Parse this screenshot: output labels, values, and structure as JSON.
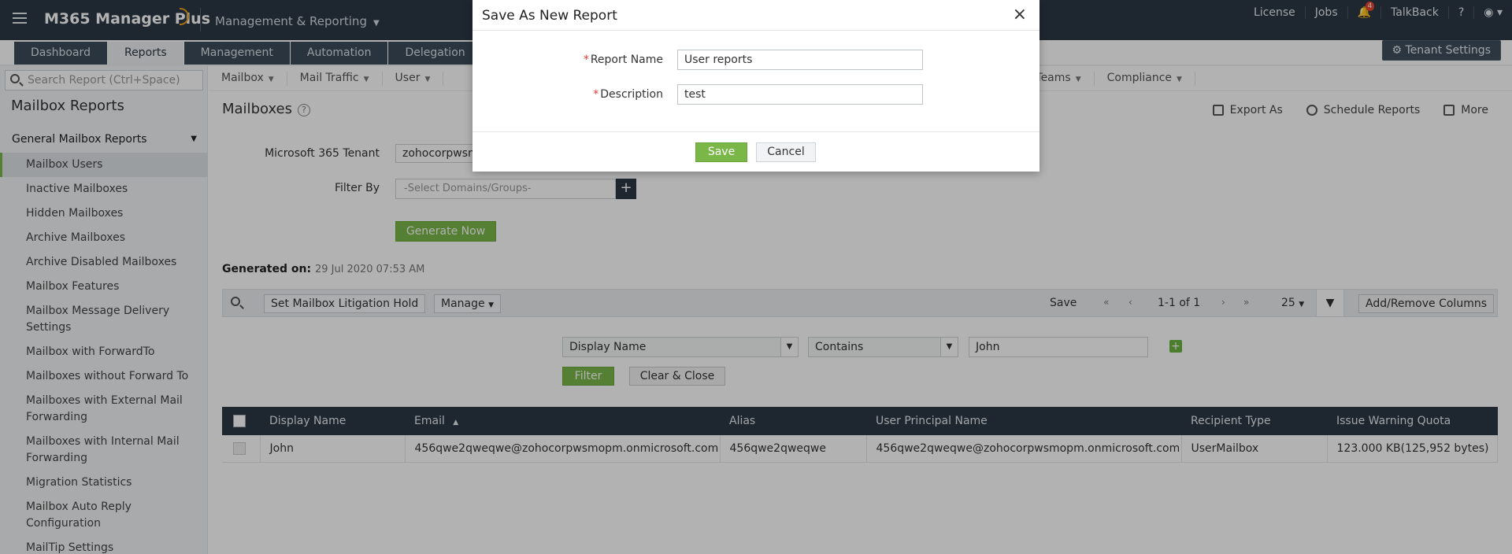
{
  "app": {
    "name": "M365 Manager Plus",
    "module": "Management & Reporting"
  },
  "top_links": {
    "license": "License",
    "jobs": "Jobs",
    "notifications_count": "4",
    "talkback": "TalkBack",
    "help": "?"
  },
  "tabs": [
    {
      "label": "Dashboard",
      "active": false
    },
    {
      "label": "Reports",
      "active": true
    },
    {
      "label": "Management",
      "active": false
    },
    {
      "label": "Automation",
      "active": false
    },
    {
      "label": "Delegation",
      "active": false
    }
  ],
  "tenant_settings_label": "Tenant Settings",
  "sidebar": {
    "search_placeholder": "Search Report (Ctrl+Space)",
    "title": "Mailbox Reports",
    "section": "General Mailbox Reports",
    "items": [
      "Mailbox Users",
      "Inactive Mailboxes",
      "Hidden Mailboxes",
      "Archive Mailboxes",
      "Archive Disabled Mailboxes",
      "Mailbox Features",
      "Mailbox Message Delivery Settings",
      "Mailbox with ForwardTo",
      "Mailboxes without Forward To",
      "Mailboxes with External Mail Forwarding",
      "Mailboxes with Internal Mail Forwarding",
      "Migration Statistics",
      "Mailbox Auto Reply Configuration",
      "MailTip Settings"
    ]
  },
  "subnav": [
    "Mailbox",
    "Mail Traffic",
    "User",
    "Teams",
    "Compliance"
  ],
  "main": {
    "title": "Mailboxes",
    "actions": {
      "export": "Export As",
      "schedule": "Schedule Reports",
      "more": "More"
    },
    "tenant_label": "Microsoft 365 Tenant",
    "tenant_value": "zohocorpwsm",
    "filter_by_label": "Filter By",
    "filter_by_placeholder": "-Select Domains/Groups-",
    "generate_button": "Generate Now",
    "generated_label": "Generated on:",
    "generated_value": "29 Jul 2020 07:53 AM"
  },
  "toolbar": {
    "litigation_button": "Set Mailbox Litigation Hold",
    "manage_button": "Manage",
    "save_label": "Save",
    "page_info": "1-1 of 1",
    "page_size": "25",
    "add_remove_columns": "Add/Remove Columns"
  },
  "filter_panel": {
    "field": "Display Name",
    "operator": "Contains",
    "value": "John",
    "filter_button": "Filter",
    "clear_button": "Clear & Close"
  },
  "table": {
    "columns": [
      "Display Name",
      "Email",
      "Alias",
      "User Principal Name",
      "Recipient Type",
      "Issue Warning Quota"
    ],
    "rows": [
      [
        "John",
        "456qwe2qweqwe@zohocorpwsmopm.onmicrosoft.com",
        "456qwe2qweqwe",
        "456qwe2qweqwe@zohocorpwsmopm.onmicrosoft.com",
        "UserMailbox",
        "123.000 KB(125,952 bytes)"
      ]
    ]
  },
  "modal": {
    "title": "Save As New Report",
    "report_name_label": "Report Name",
    "report_name_value": "User reports",
    "description_label": "Description",
    "description_value": "test",
    "save_button": "Save",
    "cancel_button": "Cancel"
  }
}
